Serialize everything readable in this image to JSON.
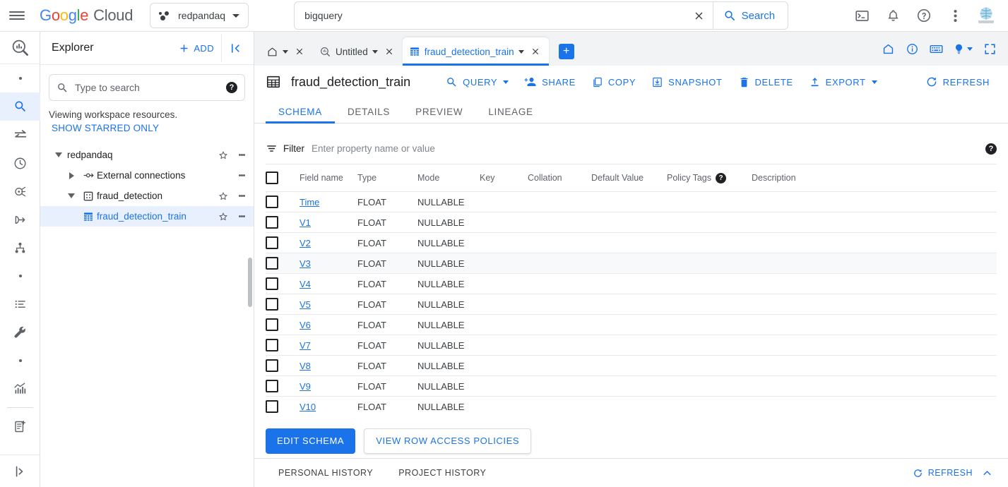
{
  "topbar": {
    "brand": {
      "g1": "G",
      "g2": "o",
      "g3": "o",
      "g4": "g",
      "g5": "l",
      "g6": "e",
      "cloud": "Cloud"
    },
    "project_chip": {
      "label": "redpandaq",
      "icon": "project-dots-icon"
    },
    "search": {
      "value": "bigquery",
      "placeholder": "Search",
      "clear_label": "✕",
      "button_label": "Search"
    },
    "icons": [
      "cloud-shell-icon",
      "notifications-icon",
      "help-icon",
      "more-options-icon",
      "avatar"
    ]
  },
  "rail": {
    "items": [
      {
        "name": "bigquery-logo-icon",
        "active": false
      },
      {
        "name": "dot-1",
        "active": false
      },
      {
        "name": "search-icon",
        "active": true
      },
      {
        "name": "transfers-icon",
        "active": false
      },
      {
        "name": "scheduled-queries-icon",
        "active": false
      },
      {
        "name": "analytics-hub-icon",
        "active": false
      },
      {
        "name": "data-transfer-icon",
        "active": false
      },
      {
        "name": "dataform-icon",
        "active": false
      },
      {
        "name": "dot-2",
        "active": false
      },
      {
        "name": "job-list-icon",
        "active": false
      },
      {
        "name": "admin-tools-icon",
        "active": false
      },
      {
        "name": "dot-3",
        "active": false
      },
      {
        "name": "monitoring-icon",
        "active": false
      },
      {
        "name": "notebook-icon",
        "active": false
      },
      {
        "name": "expand-rail-icon",
        "active": false
      }
    ]
  },
  "explorer": {
    "title": "Explorer",
    "add_label": "ADD",
    "collapse_label": "collapse-panel-icon",
    "search_placeholder": "Type to search",
    "note": "Viewing workspace resources.",
    "starred_label": "SHOW STARRED ONLY",
    "tree": [
      {
        "label": "redpandaq",
        "level": 0,
        "twisty": "down",
        "icon": "none",
        "star": true,
        "kebab": true,
        "selected": false,
        "link": false
      },
      {
        "label": "External connections",
        "level": 1,
        "twisty": "right",
        "icon": "external",
        "star": false,
        "kebab": true,
        "selected": false,
        "link": false
      },
      {
        "label": "fraud_detection",
        "level": 1,
        "twisty": "down",
        "icon": "dataset",
        "star": true,
        "kebab": true,
        "selected": false,
        "link": false
      },
      {
        "label": "fraud_detection_train",
        "level": 2,
        "twisty": "none",
        "icon": "table",
        "star": true,
        "kebab": true,
        "selected": true,
        "link": true
      }
    ]
  },
  "tabstrip": {
    "tabs": [
      {
        "label": "",
        "icon": "home-icon",
        "active": false,
        "caret": true,
        "close": true
      },
      {
        "label": "Untitled",
        "icon": "query-icon",
        "active": false,
        "caret": true,
        "close": true
      },
      {
        "label": "fraud_detection_train",
        "icon": "table-icon",
        "active": true,
        "caret": true,
        "close": true
      }
    ],
    "add_tab_label": "+",
    "right_icons": [
      "home-icon",
      "info-icon",
      "keyboard-shortcuts-icon",
      "tips-icon",
      "fullscreen-icon"
    ]
  },
  "document": {
    "icon": "table-icon",
    "title": "fraud_detection_train",
    "actions": [
      {
        "label": "QUERY",
        "icon": "search-icon",
        "caret": true
      },
      {
        "label": "SHARE",
        "icon": "person-add-icon",
        "caret": false
      },
      {
        "label": "COPY",
        "icon": "copy-icon",
        "caret": false
      },
      {
        "label": "SNAPSHOT",
        "icon": "snapshot-icon",
        "caret": false
      },
      {
        "label": "DELETE",
        "icon": "trash-icon",
        "caret": false
      },
      {
        "label": "EXPORT",
        "icon": "export-icon",
        "caret": true
      }
    ],
    "refresh_label": "REFRESH",
    "subtabs": [
      {
        "label": "SCHEMA",
        "active": true
      },
      {
        "label": "DETAILS",
        "active": false
      },
      {
        "label": "PREVIEW",
        "active": false
      },
      {
        "label": "LINEAGE",
        "active": false
      }
    ]
  },
  "schema": {
    "filter_label": "Filter",
    "filter_placeholder": "Enter property name or value",
    "filter_value": "",
    "help_icon": "help-icon",
    "columns": [
      "Field name",
      "Type",
      "Mode",
      "Key",
      "Collation",
      "Default Value",
      "Policy Tags",
      "Description"
    ],
    "policy_tags_help": "help-icon",
    "rows": [
      {
        "field": "Time",
        "type": "FLOAT",
        "mode": "NULLABLE",
        "key": "",
        "collation": "",
        "default": "",
        "policy_tags": "",
        "description": "",
        "hover": false
      },
      {
        "field": "V1",
        "type": "FLOAT",
        "mode": "NULLABLE",
        "key": "",
        "collation": "",
        "default": "",
        "policy_tags": "",
        "description": "",
        "hover": false
      },
      {
        "field": "V2",
        "type": "FLOAT",
        "mode": "NULLABLE",
        "key": "",
        "collation": "",
        "default": "",
        "policy_tags": "",
        "description": "",
        "hover": false
      },
      {
        "field": "V3",
        "type": "FLOAT",
        "mode": "NULLABLE",
        "key": "",
        "collation": "",
        "default": "",
        "policy_tags": "",
        "description": "",
        "hover": true
      },
      {
        "field": "V4",
        "type": "FLOAT",
        "mode": "NULLABLE",
        "key": "",
        "collation": "",
        "default": "",
        "policy_tags": "",
        "description": "",
        "hover": false
      },
      {
        "field": "V5",
        "type": "FLOAT",
        "mode": "NULLABLE",
        "key": "",
        "collation": "",
        "default": "",
        "policy_tags": "",
        "description": "",
        "hover": false
      },
      {
        "field": "V6",
        "type": "FLOAT",
        "mode": "NULLABLE",
        "key": "",
        "collation": "",
        "default": "",
        "policy_tags": "",
        "description": "",
        "hover": false
      },
      {
        "field": "V7",
        "type": "FLOAT",
        "mode": "NULLABLE",
        "key": "",
        "collation": "",
        "default": "",
        "policy_tags": "",
        "description": "",
        "hover": false
      },
      {
        "field": "V8",
        "type": "FLOAT",
        "mode": "NULLABLE",
        "key": "",
        "collation": "",
        "default": "",
        "policy_tags": "",
        "description": "",
        "hover": false
      },
      {
        "field": "V9",
        "type": "FLOAT",
        "mode": "NULLABLE",
        "key": "",
        "collation": "",
        "default": "",
        "policy_tags": "",
        "description": "",
        "hover": false
      },
      {
        "field": "V10",
        "type": "FLOAT",
        "mode": "NULLABLE",
        "key": "",
        "collation": "",
        "default": "",
        "policy_tags": "",
        "description": "",
        "hover": false
      }
    ],
    "edit_schema_label": "EDIT SCHEMA",
    "view_policies_label": "VIEW ROW ACCESS POLICIES"
  },
  "history": {
    "tabs": [
      "PERSONAL HISTORY",
      "PROJECT HISTORY"
    ],
    "refresh_label": "REFRESH",
    "collapse_icon": "chevron-up-icon"
  },
  "colors": {
    "accent": "#1a73e8",
    "selected_bg": "#e8f0fe",
    "hover_bg": "#f8f9fa",
    "border": "#e0e0e0",
    "text": "#202124",
    "muted": "#5f6368"
  }
}
